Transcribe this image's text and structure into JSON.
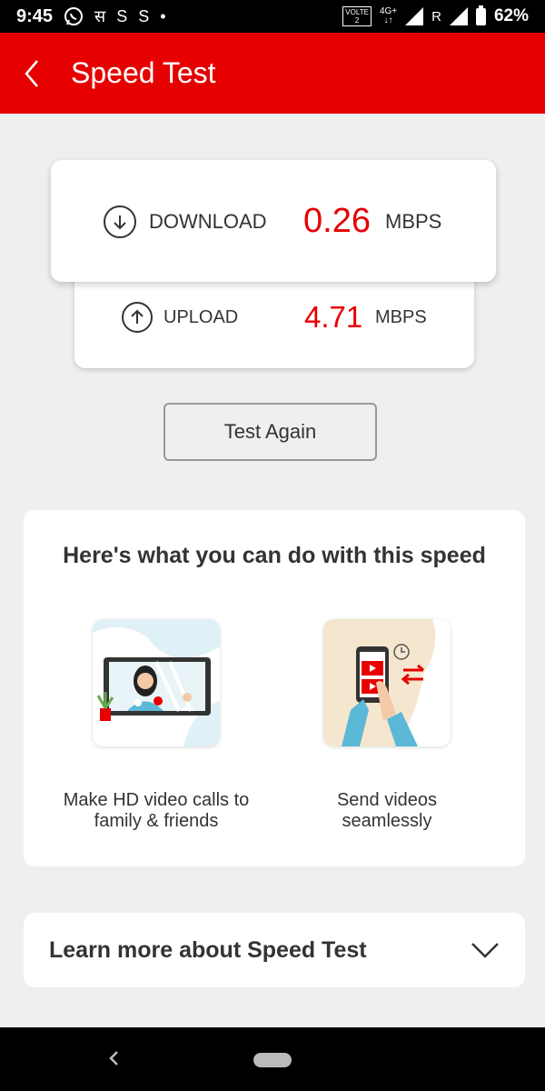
{
  "status": {
    "time": "9:45",
    "battery": "62%",
    "volte_top": "VOLTE",
    "volte_bottom": "2",
    "network_type": "4G+",
    "roaming": "R",
    "notif_icons": [
      "whatsapp-icon",
      "hindi-app-icon",
      "s-app-icon",
      "s-app-icon",
      "dot-icon"
    ]
  },
  "appbar": {
    "title": "Speed Test",
    "color": "#e60000"
  },
  "download": {
    "label": "DOWNLOAD",
    "value": "0.26",
    "unit": "MBPS"
  },
  "upload": {
    "label": "UPLOAD",
    "value": "4.71",
    "unit": "MBPS"
  },
  "test_again_label": "Test Again",
  "info": {
    "title": "Here's what you can do with this speed",
    "features": [
      {
        "caption_line1": "Make HD video calls to",
        "caption_line2": "family & friends",
        "icon": "video-call-illustration"
      },
      {
        "caption_line1": "Send videos",
        "caption_line2": "seamlessly",
        "icon": "send-video-illustration"
      }
    ]
  },
  "learn_more": {
    "label": "Learn more about Speed Test"
  }
}
